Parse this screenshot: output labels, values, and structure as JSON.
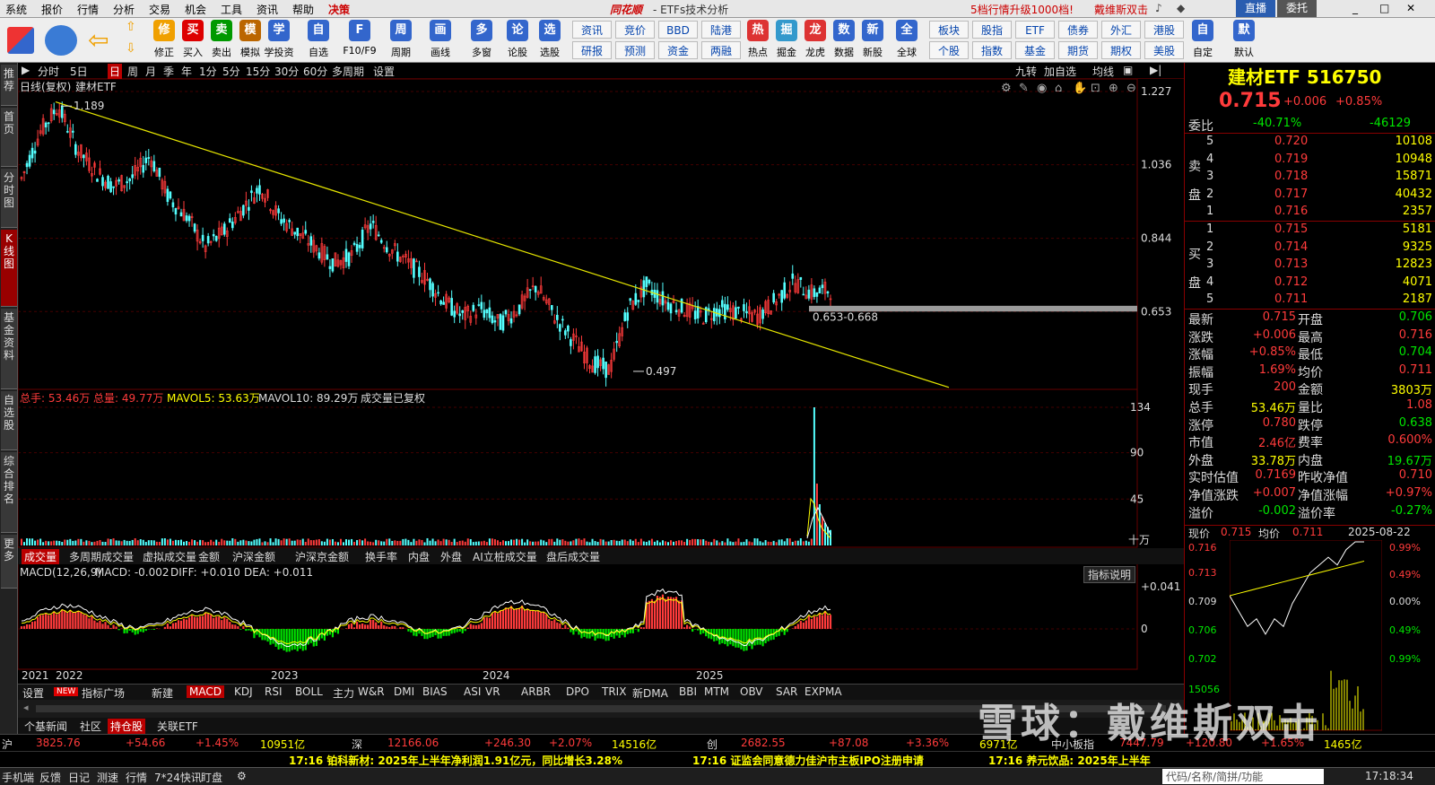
{
  "menu": [
    "系统",
    "报价",
    "行情",
    "分析",
    "交易",
    "机会",
    "工具",
    "资讯",
    "帮助",
    "决策"
  ],
  "brand": "同花顺",
  "window_title": "- ETFs技术分析",
  "promo": "5档行情升级1000档!",
  "user": "戴维斯双击",
  "topbtn": {
    "live": "直播",
    "order": "委托"
  },
  "toolbar_items": [
    {
      "label": "修正",
      "icon": "refresh-icon",
      "color": "#f0a000"
    },
    {
      "label": "买入",
      "icon": "buy-icon",
      "color": "#d00"
    },
    {
      "label": "卖出",
      "icon": "sell-icon",
      "color": "#090"
    },
    {
      "label": "模拟",
      "icon": "hammer-icon",
      "color": "#b60"
    },
    {
      "label": "学投资",
      "icon": "person-icon",
      "color": "#36c"
    },
    {
      "label": "自选",
      "icon": "star-icon",
      "color": "#36c"
    },
    {
      "label": "F10/F9",
      "icon": "f10-icon",
      "color": "#36c"
    },
    {
      "label": "周期",
      "icon": "clock-icon",
      "color": "#36c"
    },
    {
      "label": "画线",
      "icon": "pen-icon",
      "color": "#36c"
    },
    {
      "label": "多窗",
      "icon": "grid-icon",
      "color": "#36c"
    },
    {
      "label": "论股",
      "icon": "talk-icon",
      "color": "#36c"
    },
    {
      "label": "选股",
      "icon": "search-icon",
      "color": "#36c"
    }
  ],
  "toolbar_grid": [
    [
      "资讯",
      "竞价",
      "BBD",
      "陆港"
    ],
    [
      "研报",
      "预测",
      "资金",
      "两融"
    ]
  ],
  "toolbar_items2": [
    {
      "label": "热点",
      "icon": "hot-icon",
      "color": "#d33"
    },
    {
      "label": "掘金",
      "icon": "gold-icon",
      "color": "#39c"
    },
    {
      "label": "龙虎",
      "icon": "dragon-icon",
      "color": "#d33"
    },
    {
      "label": "数据",
      "icon": "pe-icon",
      "color": "#36c"
    },
    {
      "label": "新股",
      "icon": "ipo-icon",
      "color": "#36c"
    },
    {
      "label": "全球",
      "icon": "globe-icon",
      "color": "#36c"
    }
  ],
  "toolbar_grid2": [
    [
      "板块",
      "股指",
      "ETF",
      "债券",
      "外汇",
      "港股"
    ],
    [
      "个股",
      "指数",
      "基金",
      "期货",
      "期权",
      "美股"
    ]
  ],
  "toolbar_items3": [
    {
      "label": "自定",
      "icon": "custom-icon",
      "color": "#36c"
    },
    {
      "label": "默认",
      "icon": "home-icon",
      "color": "#36c"
    }
  ],
  "leftnav": [
    "推荐",
    "首页",
    "分时图",
    "K线图",
    "基金资料",
    "自选股",
    "综合排名",
    "更多"
  ],
  "periods": [
    "分时",
    "5日",
    "日",
    "周",
    "月",
    "季",
    "年",
    "1分",
    "5分",
    "15分",
    "30分",
    "60分",
    "多周期",
    "设置"
  ],
  "period_right": [
    "九转",
    "加自选",
    "均线"
  ],
  "chart_header": {
    "mode": "日线(复权)",
    "name": "建材ETF"
  },
  "chart_data": {
    "type": "candlestick",
    "title": "建材ETF",
    "x_labels": [
      "2021",
      "2022",
      "2023",
      "2024",
      "2025"
    ],
    "y_ticks": [
      "1.227",
      "1.036",
      "0.844",
      "0.653"
    ],
    "ylim": [
      0.45,
      1.227
    ],
    "annotations": [
      {
        "text": "1.189",
        "value": 1.189
      },
      {
        "text": "0.497",
        "value": 0.497
      },
      {
        "text": "0.653-0.668",
        "value": 0.66
      }
    ],
    "trendline": {
      "from": [
        "2021-12",
        "1.19"
      ],
      "to": [
        "2025-08",
        "0.653"
      ]
    },
    "price_path": [
      1.0,
      1.12,
      1.19,
      1.08,
      1.02,
      0.98,
      1.0,
      1.06,
      0.95,
      0.9,
      0.82,
      0.86,
      0.92,
      0.98,
      0.9,
      0.86,
      0.82,
      0.78,
      0.8,
      0.88,
      0.82,
      0.78,
      0.74,
      0.68,
      0.64,
      0.66,
      0.62,
      0.66,
      0.72,
      0.64,
      0.58,
      0.52,
      0.5,
      0.66,
      0.72,
      0.68,
      0.66,
      0.64,
      0.66,
      0.65,
      0.64,
      0.68,
      0.73,
      0.7,
      0.71
    ],
    "volume": {
      "legend": {
        "total": "总手: 53.46万",
        "sum": "总量: 49.77万",
        "mavol5": "MAVOL5: 53.63万",
        "mavol10": "MAVOL10: 89.29万",
        "note": "成交量已复权"
      },
      "y_ticks": [
        "134",
        "90",
        "45",
        "十万"
      ],
      "spike": 134
    },
    "macd": {
      "legend": {
        "name": "MACD(12,26,9)",
        "macd": "MACD: -0.002",
        "diff": "DIFF: +0.010",
        "dea": "DEA: +0.011"
      },
      "y_ticks": [
        "+0.041",
        "0"
      ]
    }
  },
  "vol_tabs": [
    "成交量",
    "多周期成交量",
    "虚拟成交量",
    "金额",
    "沪深金额",
    "沪深京金额",
    "换手率",
    "内盘",
    "外盘",
    "AI立桩成交量",
    "盘后成交量"
  ],
  "macd_hint": "指标说明",
  "ind_tabs": [
    "设置",
    "NEW",
    "指标广场",
    "新建",
    "MACD",
    "KDJ",
    "RSI",
    "BOLL",
    "主力",
    "W&R",
    "DMI",
    "BIAS",
    "ASI",
    "VR",
    "ARBR",
    "DPO",
    "TRIX",
    "新DMA",
    "BBI",
    "MTM",
    "OBV",
    "SAR",
    "EXPMA"
  ],
  "bottom_tabs": [
    "个基新闻",
    "社区",
    "持仓股",
    "关联ETF"
  ],
  "quote": {
    "title": "建材ETF 516750",
    "price": "0.715",
    "chg": "+0.006",
    "pct": "+0.85%",
    "weibi": {
      "label": "委比",
      "pct": "-40.71%",
      "diff": "-46129"
    },
    "sell_label": "卖盘",
    "buy_label": "买盘",
    "sell": [
      [
        "5",
        "0.720",
        "10108"
      ],
      [
        "4",
        "0.719",
        "10948"
      ],
      [
        "3",
        "0.718",
        "15871"
      ],
      [
        "2",
        "0.717",
        "40432"
      ],
      [
        "1",
        "0.716",
        "2357"
      ]
    ],
    "buy": [
      [
        "1",
        "0.715",
        "5181"
      ],
      [
        "2",
        "0.714",
        "9325"
      ],
      [
        "3",
        "0.713",
        "12823"
      ],
      [
        "4",
        "0.712",
        "4071"
      ],
      [
        "5",
        "0.711",
        "2187"
      ]
    ],
    "stats": [
      [
        "最新",
        "0.715",
        "开盘",
        "0.706"
      ],
      [
        "涨跌",
        "+0.006",
        "最高",
        "0.716"
      ],
      [
        "涨幅",
        "+0.85%",
        "最低",
        "0.704"
      ],
      [
        "振幅",
        "1.69%",
        "均价",
        "0.711"
      ],
      [
        "现手",
        "200",
        "金额",
        "3803万"
      ],
      [
        "总手",
        "53.46万",
        "量比",
        "1.08"
      ],
      [
        "涨停",
        "0.780",
        "跌停",
        "0.638"
      ],
      [
        "市值",
        "2.46亿",
        "费率",
        "0.600%"
      ],
      [
        "外盘",
        "33.78万",
        "内盘",
        "19.67万"
      ],
      [
        "实时估值",
        "0.7169",
        "昨收净值",
        "0.710"
      ],
      [
        "净值涨跌",
        "+0.007",
        "净值涨幅",
        "+0.97%"
      ],
      [
        "溢价",
        "-0.002",
        "溢价率",
        "-0.27%"
      ]
    ]
  },
  "mini": {
    "header": [
      "现价",
      "0.715",
      "均价",
      "0.711",
      "2025-08-22"
    ],
    "left_ticks": [
      "0.716",
      "0.713",
      "0.709",
      "0.706",
      "0.702",
      "15056"
    ],
    "right_ticks": [
      "0.99%",
      "0.49%",
      "0.00%",
      "0.49%",
      "0.99%"
    ],
    "path": [
      0.709,
      0.707,
      0.705,
      0.706,
      0.704,
      0.706,
      0.705,
      0.708,
      0.71,
      0.712,
      0.713,
      0.714,
      0.713,
      0.715,
      0.716,
      0.716
    ]
  },
  "indices": [
    {
      "name": "沪",
      "val": "3825.76",
      "chg": "+54.66",
      "pct": "+1.45%",
      "amt": "10951亿"
    },
    {
      "name": "深",
      "val": "12166.06",
      "chg": "+246.30",
      "pct": "+2.07%",
      "amt": "14516亿"
    },
    {
      "name": "创",
      "val": "2682.55",
      "chg": "+87.08",
      "pct": "+3.36%",
      "amt": "6971亿"
    },
    {
      "name": "中小板指",
      "val": "7447.79",
      "chg": "+120.80",
      "pct": "+1.65%",
      "amt": "1465亿"
    }
  ],
  "news": [
    "17:16 铂科新材: 2025年上半年净利润1.91亿元，同比增长3.28%",
    "17:16 证监会同意德力佳沪市主板IPO注册申请",
    "17:16 养元饮品: 2025年上半年"
  ],
  "status": [
    "手机端",
    "反馈",
    "日记",
    "测速",
    "行情",
    "7*24快讯",
    "盯盘"
  ],
  "status_right": {
    "search": "代码/名称/简拼/功能",
    "time": "17:18:34"
  },
  "watermark": "雪球：戴维斯双击"
}
